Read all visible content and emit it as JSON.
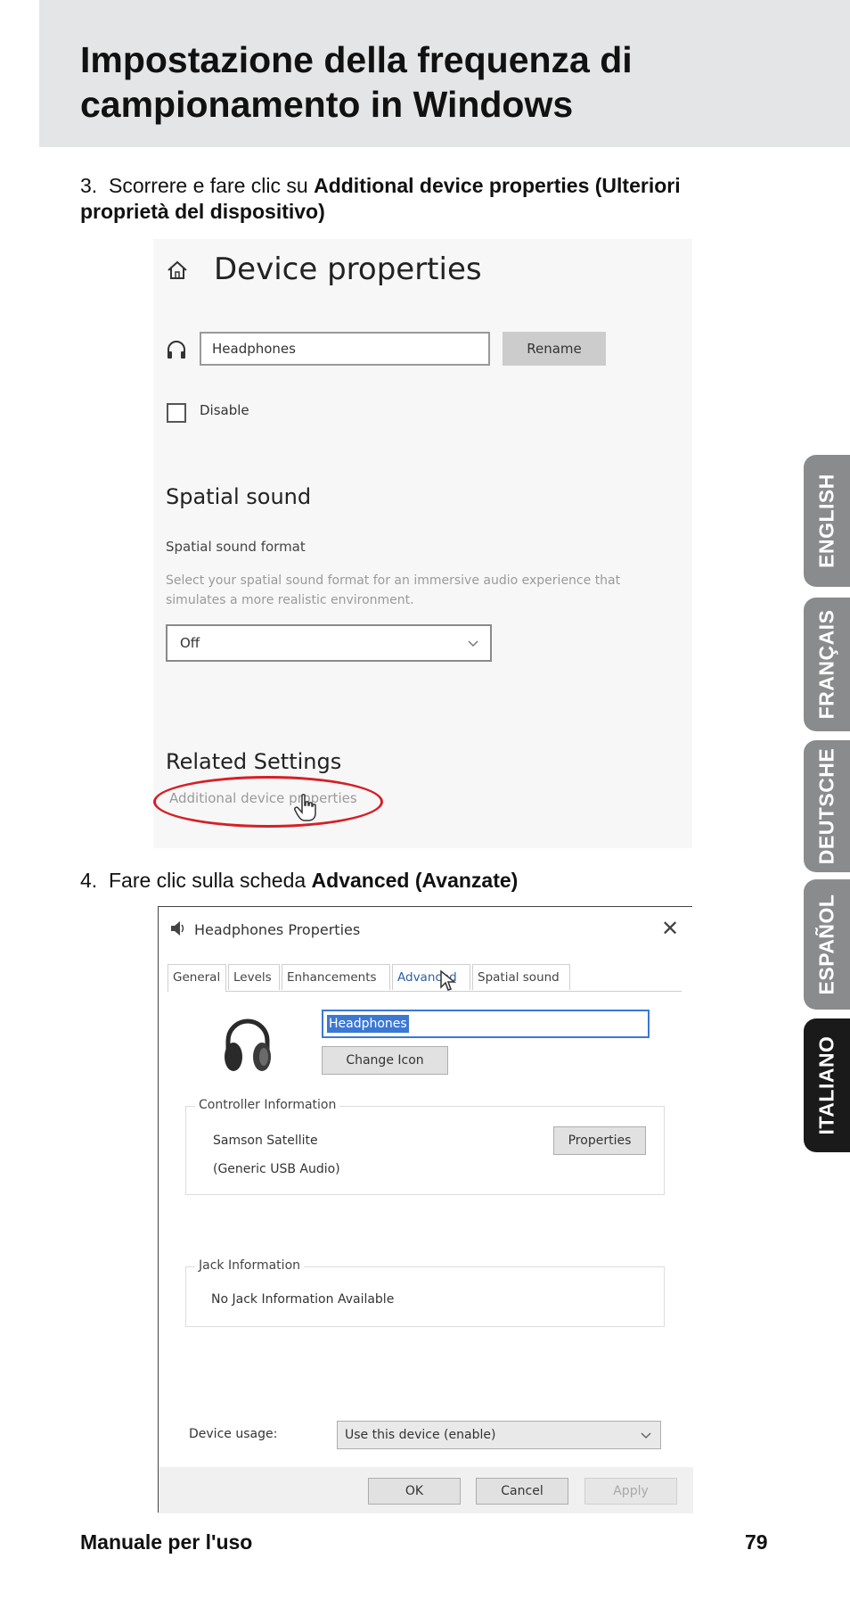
{
  "header": {
    "title": "Impostazione della frequenza di campionamento in Windows"
  },
  "steps": [
    {
      "number": "3.",
      "text": "Scorrere e fare clic su ",
      "bold": "Additional device properties (Ulteriori proprietà del dispositivo)"
    },
    {
      "number": "4.",
      "text": "Fare clic sulla scheda ",
      "bold": "Advanced (Avanzate)"
    }
  ],
  "screenshot1": {
    "title": "Device properties",
    "name_value": "Headphones",
    "rename_label": "Rename",
    "disable_label": "Disable",
    "spatial_title": "Spatial sound",
    "spatial_format_label": "Spatial sound format",
    "spatial_description": "Select your spatial sound format for an immersive audio experience that simulates a more realistic environment.",
    "spatial_value": "Off",
    "related_title": "Related Settings",
    "additional_link": "Additional device properties",
    "highlight_color": "#d61f26"
  },
  "screenshot2": {
    "title": "Headphones Properties",
    "close": "✕",
    "tabs": [
      "General",
      "Levels",
      "Enhancements",
      "Advanced",
      "Spatial sound"
    ],
    "name_value": "Headphones",
    "change_icon_label": "Change Icon",
    "controller_legend": "Controller Information",
    "controller_name": "Samson Satellite",
    "controller_driver": "(Generic USB Audio)",
    "properties_label": "Properties",
    "jack_legend": "Jack Information",
    "jack_text": "No Jack Information Available",
    "usage_label": "Device usage:",
    "usage_value": "Use this device (enable)",
    "ok_label": "OK",
    "cancel_label": "Cancel",
    "apply_label": "Apply"
  },
  "footer": {
    "manual_label": "Manuale per l'uso",
    "page_number": "79"
  },
  "languages": [
    {
      "label": "ENGLISH",
      "active": false
    },
    {
      "label": "FRANÇAIS",
      "active": false
    },
    {
      "label": "DEUTSCHE",
      "active": false
    },
    {
      "label": "ESPAÑOL",
      "active": false
    },
    {
      "label": "ITALIANO",
      "active": true
    }
  ],
  "colors": {
    "header_band": "#e4e5e6",
    "tab_inactive": "#8a8b8d",
    "tab_active": "#1a1a1a",
    "selection_blue": "#3b78d4"
  }
}
